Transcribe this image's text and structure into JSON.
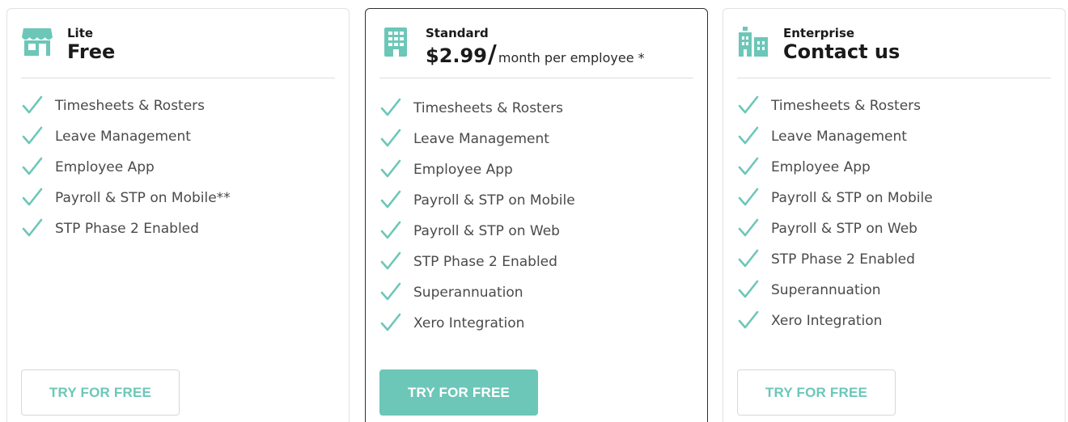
{
  "colors": {
    "accent": "#6cc7b8",
    "featured_border": "#2f2f2f",
    "divider": "#dcdcdc"
  },
  "plans": [
    {
      "tier": "Lite",
      "price": "Free",
      "unit": "",
      "icon": "storefront-icon",
      "features": [
        "Timesheets & Rosters",
        "Leave Management",
        "Employee App",
        "Payroll & STP on Mobile**",
        "STP Phase 2 Enabled"
      ],
      "cta": "TRY FOR FREE",
      "featured": false
    },
    {
      "tier": "Standard",
      "price": "$2.99",
      "unit": "month per employee *",
      "icon": "office-building-icon",
      "features": [
        "Timesheets & Rosters",
        "Leave Management",
        "Employee App",
        "Payroll & STP on Mobile",
        "Payroll & STP on Web",
        "STP Phase 2 Enabled",
        "Superannuation",
        "Xero Integration"
      ],
      "cta": "TRY FOR FREE",
      "featured": true
    },
    {
      "tier": "Enterprise",
      "price": "Contact us",
      "unit": "",
      "icon": "city-buildings-icon",
      "features": [
        "Timesheets & Rosters",
        "Leave Management",
        "Employee App",
        "Payroll & STP on Mobile",
        "Payroll & STP on Web",
        "STP Phase 2 Enabled",
        "Superannuation",
        "Xero Integration"
      ],
      "cta": "TRY FOR FREE",
      "featured": false
    }
  ]
}
